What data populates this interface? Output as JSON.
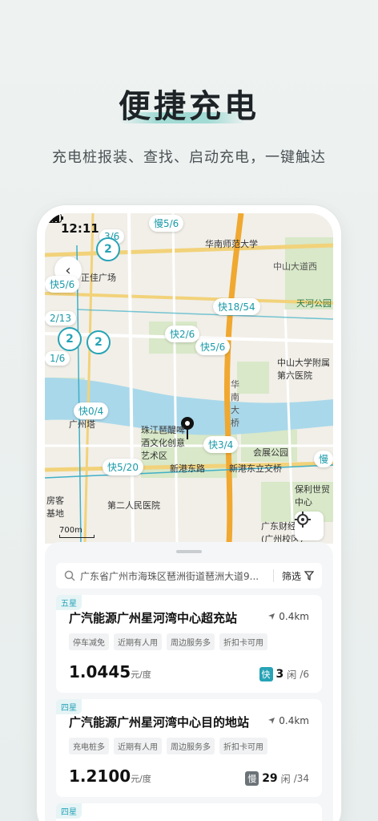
{
  "headline": "便捷充电",
  "subline": "充电桩报装、查找、启动充电，一键触达",
  "status": {
    "time": "12:11"
  },
  "map": {
    "labels": [
      {
        "text": "华南师范大学"
      },
      {
        "text": "中山大道西"
      },
      {
        "text": "正佳广场"
      },
      {
        "text": "天河公园"
      },
      {
        "text": "中山大学附属第六医院"
      },
      {
        "text": "广州塔"
      },
      {
        "text": "珠江琶醍啤酒文化创意艺术区"
      },
      {
        "text": "会展公园"
      },
      {
        "text": "新港东路"
      },
      {
        "text": "新港东立交桥"
      },
      {
        "text": "保利世贸中心"
      },
      {
        "text": "第二人民医院"
      },
      {
        "text": "广东财经大学(广州校区)"
      },
      {
        "text": "华南大桥"
      },
      {
        "text": "房客基地"
      }
    ],
    "pins": [
      {
        "text": "慢5/6"
      },
      {
        "text": "3/6"
      },
      {
        "text": "快5/6"
      },
      {
        "text": "2/13"
      },
      {
        "text": "快18/54"
      },
      {
        "text": "快2/6"
      },
      {
        "text": "快5/6"
      },
      {
        "text": "1/6"
      },
      {
        "text": "快0/4"
      },
      {
        "text": "快3/4"
      },
      {
        "text": "快5/20"
      },
      {
        "text": "慢"
      }
    ],
    "clusters": [
      "2",
      "2",
      "2"
    ],
    "scale": "700m"
  },
  "search": {
    "address": "广东省广州市海珠区琶洲街道琶洲大道9...",
    "filter_label": "筛选"
  },
  "stations": [
    {
      "tier": "五星",
      "name": "广汽能源广州星河湾中心超充站",
      "distance": "0.4km",
      "tags": [
        "停车减免",
        "近期有人用",
        "周边服务多",
        "折扣卡可用"
      ],
      "price": "1.0445",
      "unit": "元/度",
      "badge": "快",
      "badge_color": "#27a3b6",
      "free": "3",
      "free_label": "闲",
      "total": "/6"
    },
    {
      "tier": "四星",
      "name": "广汽能源广州星河湾中心目的地站",
      "distance": "0.4km",
      "tags": [
        "充电桩多",
        "近期有人用",
        "周边服务多",
        "折扣卡可用"
      ],
      "price": "1.2100",
      "unit": "元/度",
      "badge": "慢",
      "badge_color": "#6b7378",
      "free": "29",
      "free_label": "闲",
      "total": "/34"
    },
    {
      "tier": "四星"
    }
  ]
}
